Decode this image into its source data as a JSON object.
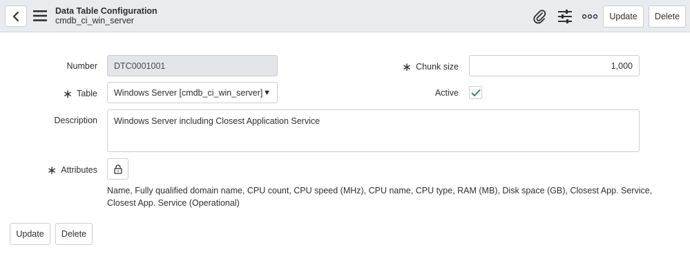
{
  "header": {
    "title": "Data Table Configuration",
    "subtitle": "cmdb_ci_win_server",
    "update_label": "Update",
    "delete_label": "Delete",
    "icons": [
      "back-icon",
      "menu-icon",
      "paperclip-icon",
      "sliders-icon",
      "more-icon"
    ]
  },
  "form": {
    "number_label": "Number",
    "number_value": "DTC0001001",
    "chunk_label": "Chunk size",
    "chunk_value": "1,000",
    "table_label": "Table",
    "table_value": "Windows Server [cmdb_ci_win_server]",
    "active_label": "Active",
    "active_checked": true,
    "description_label": "Description",
    "description_value": "Windows Server including Closest Application Service",
    "attributes_label": "Attributes",
    "attributes_value": "Name, Fully qualified domain name, CPU count, CPU speed (MHz), CPU name, CPU type, RAM (MB), Disk space (GB), Closest App. Service, Closest App. Service (Operational)",
    "required_mark": "∗"
  },
  "footer": {
    "update_label": "Update",
    "delete_label": "Delete"
  },
  "colors": {
    "header_bg": "#e9ebee",
    "check_color": "#2e8a60",
    "readonly_bg": "#e3e5e8"
  }
}
